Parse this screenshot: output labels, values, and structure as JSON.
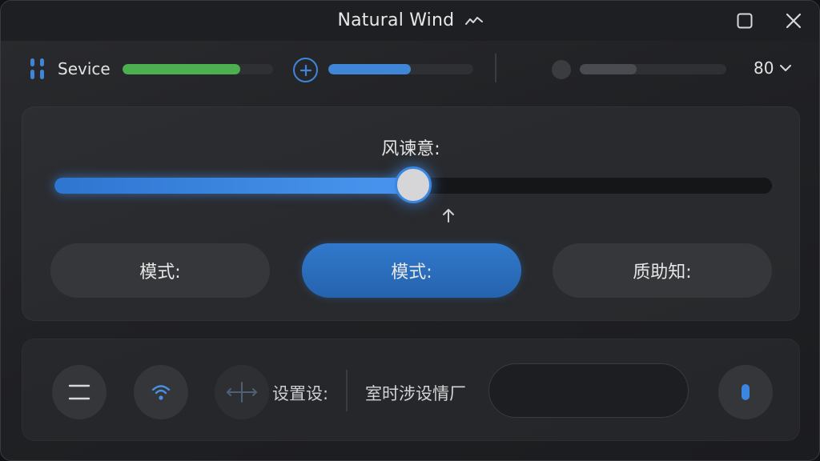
{
  "window": {
    "title": "Natural Wind",
    "title_icon": "wave-trend-icon"
  },
  "status": {
    "device_label": "Sevice",
    "device_icon": "device-bars-icon",
    "green_level": 0.78,
    "blue_level": 0.57,
    "dim_level": 0.39,
    "value": "80",
    "colors": {
      "green": "#4caf50",
      "blue": "#3f86d8",
      "gray": "#4a4b50"
    }
  },
  "main": {
    "speed_label": "风谏意:",
    "speed_level": 0.5,
    "mode_buttons": [
      {
        "label": "模式:",
        "active": false
      },
      {
        "label": "模式:",
        "active": true
      },
      {
        "label": "质助知:",
        "active": false
      }
    ]
  },
  "bottom": {
    "settings_label": "设置设:",
    "room_label": "室时涉设情厂",
    "input_value": "",
    "buttons": [
      "menu-icon",
      "wifi-icon",
      "move-icon",
      "mic-icon"
    ]
  }
}
